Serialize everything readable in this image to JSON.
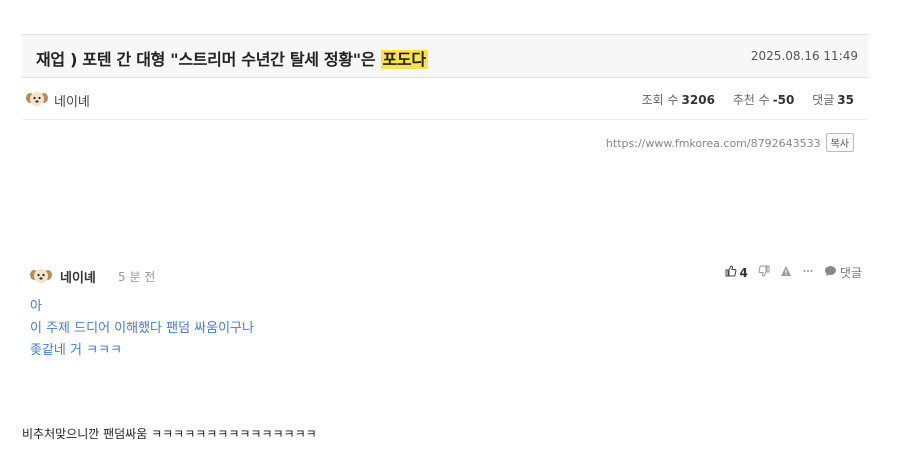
{
  "post": {
    "title_main": "재업 ) 포텐 간 대형 \"스트리머 수년간 탈세 정황\"은",
    "title_highlight": "포도다",
    "date": "2025.08.16 11:49",
    "author": "네이녜",
    "stats": {
      "views_label": "조회 수",
      "views": "3206",
      "recommend_label": "추천 수",
      "recommend": "-50",
      "comments_label": "댓글",
      "comments": "35"
    },
    "url": "https://www.fmkorea.com/8792643533",
    "copy_label": "복사"
  },
  "comment": {
    "author": "네이녜",
    "time": "5 분 전",
    "likes": "4",
    "reply_label": "댓글",
    "lines": [
      "아",
      "이 주제 드디어 이해했다 팬덤 싸움이구나",
      "좆같네 거 ㅋㅋㅋ"
    ]
  },
  "next_text": "비추처맞으니깐 팬덤싸움 ㅋㅋㅋㅋㅋㅋㅋㅋㅋㅋㅋㅋㅋㅋㅋ",
  "colors": {
    "highlight": "#ffe24d",
    "comment_text": "#4a7cc9"
  },
  "icons": [
    "dog-avatar-icon",
    "thumbs-up-icon",
    "thumbs-down-icon",
    "warning-icon",
    "more-icon",
    "chat-bubble-icon"
  ]
}
